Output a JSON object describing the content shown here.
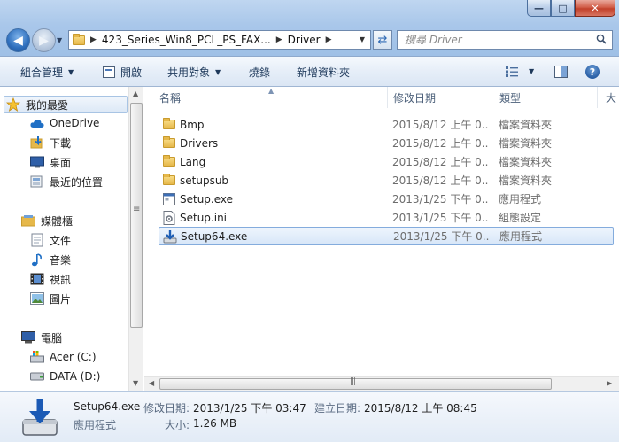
{
  "window": {
    "minimize_glyph": "—",
    "maximize_glyph": "□",
    "close_glyph": "✕"
  },
  "address": {
    "crumbs": [
      "423_Series_Win8_PCL_PS_FAX...",
      "Driver"
    ],
    "search_placeholder": "搜尋 Driver"
  },
  "toolbar": {
    "organize": "組合管理",
    "open": "開啟",
    "share": "共用對象",
    "burn": "燒錄",
    "new_folder": "新增資料夾",
    "help": "?"
  },
  "sidebar": {
    "favorites": {
      "label": "我的最愛",
      "items": [
        "OneDrive",
        "下載",
        "桌面",
        "最近的位置"
      ]
    },
    "libraries": {
      "label": "媒體櫃",
      "items": [
        "文件",
        "音樂",
        "視訊",
        "圖片"
      ]
    },
    "computer": {
      "label": "電腦",
      "items": [
        "Acer (C:)",
        "DATA (D:)"
      ]
    }
  },
  "columns": {
    "name": "名稱",
    "date": "修改日期",
    "type": "類型",
    "size": "大"
  },
  "files": [
    {
      "name": "Bmp",
      "date": "2015/8/12 上午 0...",
      "type": "檔案資料夾",
      "icon": "folder-icon"
    },
    {
      "name": "Drivers",
      "date": "2015/8/12 上午 0...",
      "type": "檔案資料夾",
      "icon": "folder-icon"
    },
    {
      "name": "Lang",
      "date": "2015/8/12 上午 0...",
      "type": "檔案資料夾",
      "icon": "folder-icon"
    },
    {
      "name": "setupsub",
      "date": "2015/8/12 上午 0...",
      "type": "檔案資料夾",
      "icon": "folder-icon"
    },
    {
      "name": "Setup.exe",
      "date": "2013/1/25 下午 0...",
      "type": "應用程式",
      "icon": "exe-icon"
    },
    {
      "name": "Setup.ini",
      "date": "2013/1/25 下午 0...",
      "type": "組態設定",
      "icon": "ini-icon"
    },
    {
      "name": "Setup64.exe",
      "date": "2013/1/25 下午 0...",
      "type": "應用程式",
      "icon": "installer-icon"
    }
  ],
  "details": {
    "filename": "Setup64.exe",
    "filetype": "應用程式",
    "modified_label": "修改日期:",
    "modified_value": "2013/1/25 下午 03:47",
    "created_label": "建立日期:",
    "created_value": "2015/8/12 上午 08:45",
    "size_label": "大小:",
    "size_value": "1.26 MB"
  }
}
